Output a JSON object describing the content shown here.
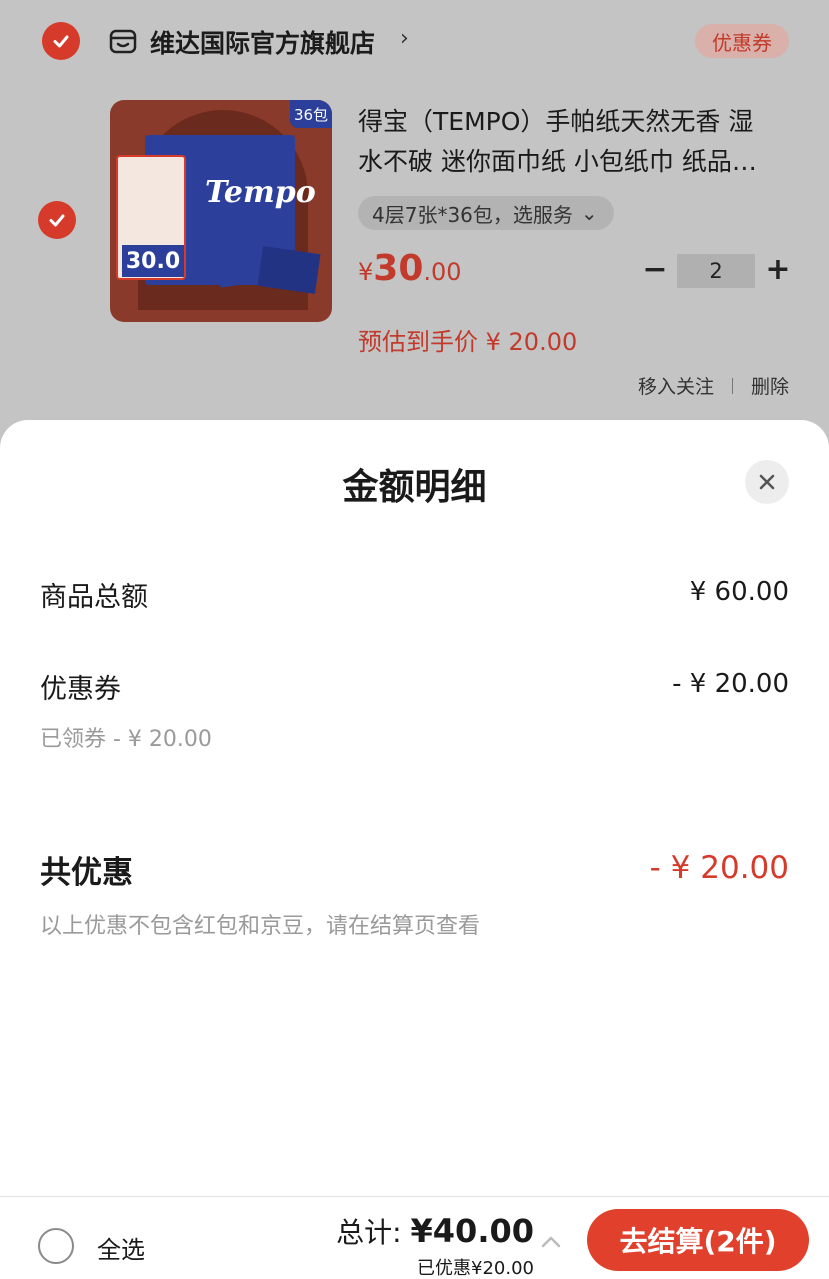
{
  "store": {
    "name": "维达国际官方旗舰店",
    "arrow": "›",
    "coupon_tag": "优惠券"
  },
  "product": {
    "title_line1": "得宝（TEMPO）手帕纸天然无香 湿",
    "title_line2": "水不破 迷你面巾纸 小包纸巾 纸品…",
    "spec": "4层7张*36包，选服务",
    "spec_chevron": "⌄",
    "price_currency": "¥",
    "price_int": "30",
    "price_dec": ".00",
    "quantity": "2",
    "minus": "−",
    "plus": "+",
    "estimated_price": "预估到手价 ¥ 20.00",
    "move_to_follow": "移入关注",
    "delete": "删除",
    "image": {
      "brand": "Tempo",
      "count_tag": "36包",
      "promo_price": "30.0"
    }
  },
  "sheet": {
    "title": "金额明细",
    "rows": [
      {
        "label": "商品总额",
        "value": "¥ 60.00"
      },
      {
        "label": "优惠券",
        "value": "- ¥ 20.00",
        "sub": "已领券 - ¥ 20.00"
      }
    ],
    "total": {
      "label": "共优惠",
      "value": "- ¥ 20.00"
    },
    "note": "以上优惠不包含红包和京豆，请在结算页查看"
  },
  "bottom": {
    "select_all": "全选",
    "sum_label": "总计: ",
    "sum_amount": "¥40.00",
    "saved": "已优惠¥20.00",
    "checkout": "去结算(2件)"
  },
  "colors": {
    "accent": "#d63a2a",
    "checkout": "#e0402c",
    "dim_bg": "#c4c4c4"
  },
  "icons": [
    "check-icon",
    "store-icon",
    "close-icon",
    "chevron-up-icon"
  ]
}
